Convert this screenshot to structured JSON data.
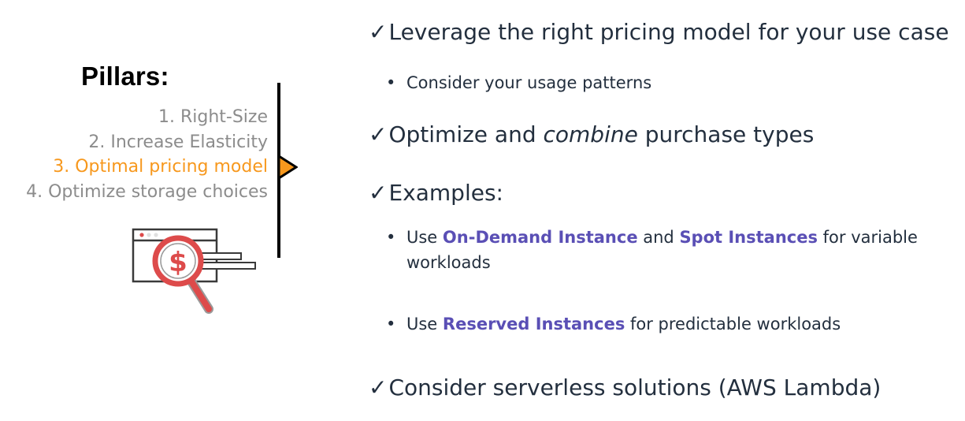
{
  "left": {
    "title": "Pillars:",
    "pillars": [
      {
        "label": "1. Right-Size",
        "active": false
      },
      {
        "label": "2. Increase Elasticity",
        "active": false
      },
      {
        "label": "3. Optimal pricing model",
        "active": true
      },
      {
        "label": "4. Optimize storage choices",
        "active": false
      }
    ],
    "illustration_icon": "magnifier-dollar-icon"
  },
  "right": {
    "checkmark": "✓",
    "bullet_char": "•",
    "check1": "Leverage the right pricing model for your use case",
    "bullet1": "Consider your usage patterns",
    "check2_pre": "Optimize and ",
    "check2_em": "combine",
    "check2_post": " purchase types",
    "check3": "Examples:",
    "bullet2_pre": "Use ",
    "bullet2_hl1": "On-Demand Instance",
    "bullet2_mid": " and ",
    "bullet2_hl2": "Spot Instances",
    "bullet2_post": " for variable workloads",
    "bullet3_pre": "Use ",
    "bullet3_hl": "Reserved Instances",
    "bullet3_post": " for predictable workloads",
    "check4": "Consider serverless solutions (AWS Lambda)"
  },
  "colors": {
    "text": "#232f3e",
    "muted": "#8c8c8c",
    "accent_orange": "#f7981d",
    "highlight_purple": "#5a4fb5",
    "magnifier_red": "#dd4b4b"
  }
}
